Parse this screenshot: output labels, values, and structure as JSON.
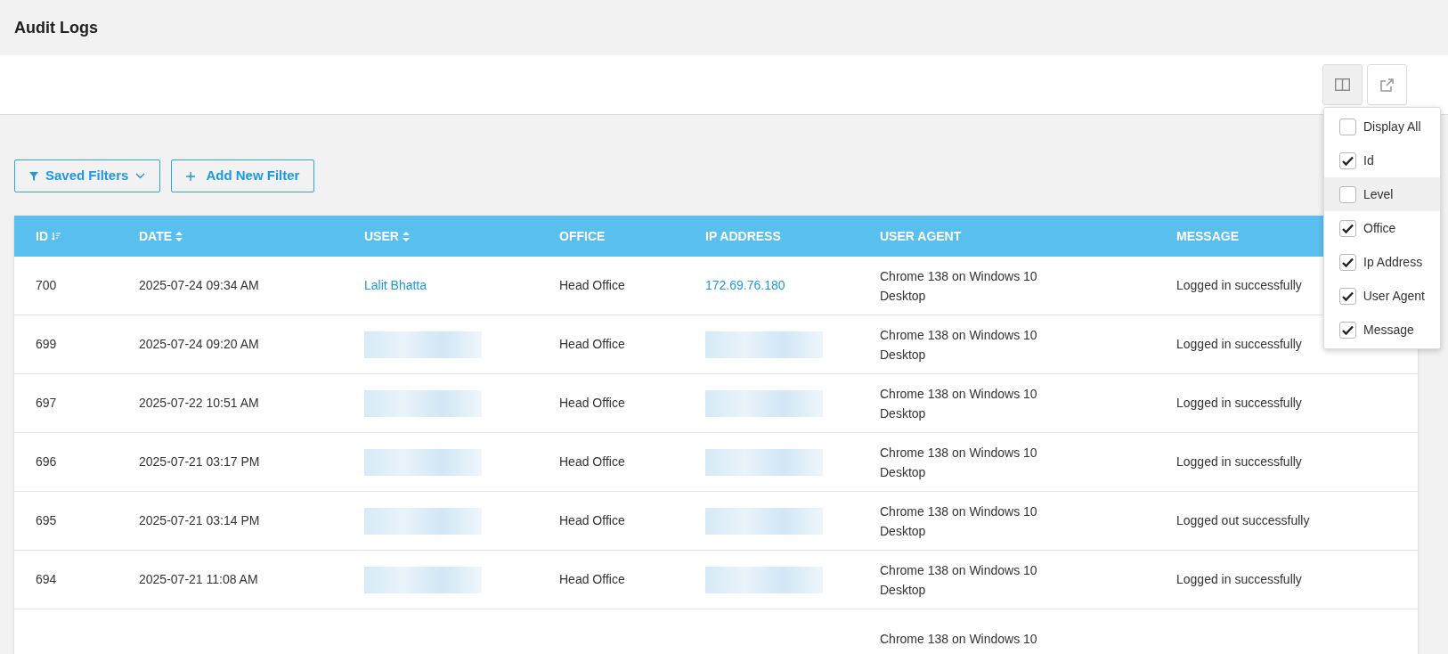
{
  "page_title": "Audit Logs",
  "toolbar": {
    "buttons": [
      {
        "kind": "columns",
        "selected": true
      },
      {
        "kind": "export",
        "selected": false
      }
    ]
  },
  "column_menu": {
    "items": [
      {
        "label": "Display All",
        "checked": false,
        "highlighted": false
      },
      {
        "label": "Id",
        "checked": true,
        "highlighted": false
      },
      {
        "label": "Level",
        "checked": false,
        "highlighted": true
      },
      {
        "label": "Office",
        "checked": true,
        "highlighted": false
      },
      {
        "label": "Ip Address",
        "checked": true,
        "highlighted": false
      },
      {
        "label": "User Agent",
        "checked": true,
        "highlighted": false
      },
      {
        "label": "Message",
        "checked": true,
        "highlighted": false
      }
    ]
  },
  "filters": {
    "saved_filters": "Saved Filters",
    "add_filter": "Add New Filter"
  },
  "table": {
    "columns": [
      {
        "label": "ID",
        "kind": "sorted"
      },
      {
        "label": "DATE",
        "kind": "sortable"
      },
      {
        "label": "USER",
        "kind": "sortable"
      },
      {
        "label": "OFFICE",
        "kind": "plain"
      },
      {
        "label": "IP ADDRESS",
        "kind": "plain"
      },
      {
        "label": "USER AGENT",
        "kind": "plain"
      },
      {
        "label": "MESSAGE",
        "kind": "plain"
      }
    ],
    "rows": [
      {
        "id": "700",
        "date": "2025-07-24 09:34 AM",
        "user": "Lalit Bhatta",
        "user_redacted": false,
        "office": "Head Office",
        "ip": "172.69.76.180",
        "ip_redacted": false,
        "user_agent": "Chrome 138 on Windows 10 Desktop",
        "message": "Logged in successfully"
      },
      {
        "id": "699",
        "date": "2025-07-24 09:20 AM",
        "user_redacted": true,
        "office": "Head Office",
        "ip_redacted": true,
        "user_agent": "Chrome 138 on Windows 10 Desktop",
        "message": "Logged in successfully"
      },
      {
        "id": "697",
        "date": "2025-07-22 10:51 AM",
        "user_redacted": true,
        "office": "Head Office",
        "ip_redacted": true,
        "user_agent": "Chrome 138 on Windows 10 Desktop",
        "message": "Logged in successfully"
      },
      {
        "id": "696",
        "date": "2025-07-21 03:17 PM",
        "user_redacted": true,
        "office": "Head Office",
        "ip_redacted": true,
        "user_agent": "Chrome 138 on Windows 10 Desktop",
        "message": "Logged in successfully"
      },
      {
        "id": "695",
        "date": "2025-07-21 03:14 PM",
        "user_redacted": true,
        "office": "Head Office",
        "ip_redacted": true,
        "user_agent": "Chrome 138 on Windows 10 Desktop",
        "message": "Logged out successfully"
      },
      {
        "id": "694",
        "date": "2025-07-21 11:08 AM",
        "user_redacted": true,
        "office": "Head Office",
        "ip_redacted": true,
        "user_agent": "Chrome 138 on Windows 10 Desktop",
        "message": "Logged in successfully"
      },
      {
        "user_agent": "Chrome 138 on Windows 10"
      }
    ]
  }
}
